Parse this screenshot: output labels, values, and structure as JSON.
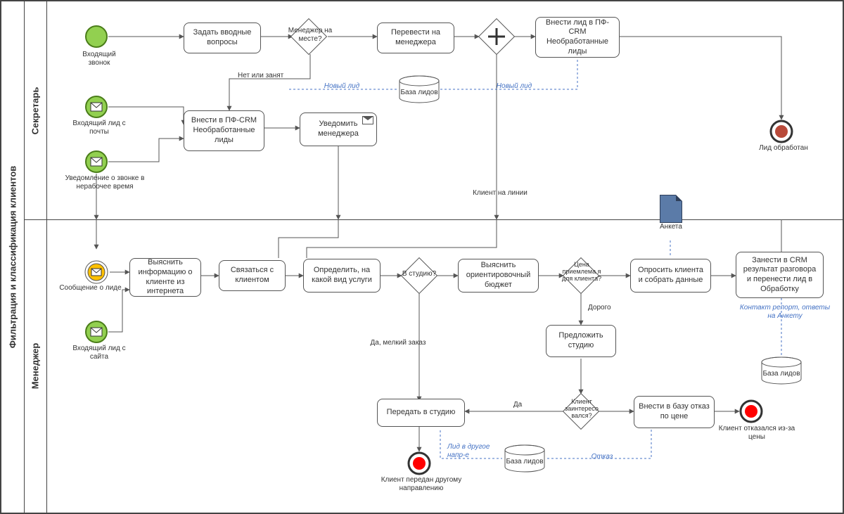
{
  "pool": {
    "title": "Фильтрация и классификация клиентов"
  },
  "lanes": {
    "secretary": {
      "title": "Секретарь"
    },
    "manager": {
      "title": "Менеджер"
    }
  },
  "secretary": {
    "start_call": "Входящий звонок",
    "ask_intro": "Задать вводные вопросы",
    "gw_mgr_there": "Менеджер на месте?",
    "gw_no_busy": "Нет или занят",
    "transfer": "Перевести на менеджера",
    "enter_lead": "Внести лид в ПФ-CRM Необработанные лиды",
    "db_leads": "База лидов",
    "new_lead": "Новый лид",
    "start_mail": "Входящий лид с почты",
    "start_offhrs": "Уведомление о звонке в нерабочее время",
    "enter_crm": "Внести в ПФ-CRM Необработанные лиды",
    "notify_mgr": "Уведомить менеджера",
    "client_on_line": "Клиент на линии",
    "end_lead_done": "Лид обработан"
  },
  "manager": {
    "msg_about_lead": "Сообщение о лиде",
    "start_site": "Входящий лид с сайта",
    "get_info": "Выяснить информацию о клиенте из интернета",
    "contact": "Связаться с клиентом",
    "define_svc": "Определить, на какой вид услуги",
    "gw_in_studio": "В студию?",
    "yes_small": "Да, мелкий заказ",
    "budget": "Выяснить ориентировочный бюджет",
    "gw_price_ok": "Цена приемлема я для клиента?",
    "expensive": "Дорого",
    "offer_studio": "Предложить студию",
    "gw_interested": "Клиент заинтересо вался?",
    "yes": "Да",
    "survey": "Опросить клиента и собрать данные",
    "questionnaire": "Анкета",
    "enter_crm_result": "Занести в CRM результат разговора и перенести лид в Обработку",
    "anno_contact_report": "Контакт репорт, ответы на Анкету",
    "db_leads2": "База лидов",
    "pass_studio": "Передать в студию",
    "end_another": "Клиент передан другому направлению",
    "anno_lead_other": "Лид в другое напр-е",
    "db_leads3": "База лидов",
    "refuse_base": "Внести в базу отказ по цене",
    "anno_refuse": "Отказ",
    "end_refused": "Клиент отказался из-за цены"
  }
}
